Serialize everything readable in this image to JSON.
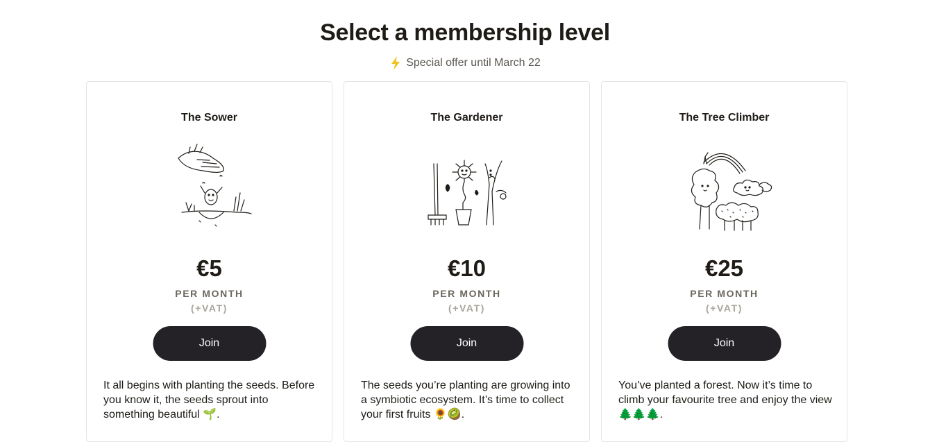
{
  "page": {
    "title": "Select a membership level",
    "offer_text": "Special offer until March 22",
    "offer_icon": "lightning-bolt-icon",
    "accent": "#f2c21b"
  },
  "plans": [
    {
      "name": "The Sower",
      "illustration": "seed-sowing-illustration",
      "price": "€5",
      "period": "PER MONTH",
      "vat": "(+VAT)",
      "button": "Join",
      "description": "It all begins with planting the seeds. Before you know it, the seeds sprout into something beautiful 🌱."
    },
    {
      "name": "The Gardener",
      "illustration": "gardener-flower-illustration",
      "price": "€10",
      "period": "PER MONTH",
      "vat": "(+VAT)",
      "button": "Join",
      "description": "The seeds you’re planting are growing into a symbiotic ecosystem. It’s time to collect your first fruits 🌻🥝."
    },
    {
      "name": "The Tree Climber",
      "illustration": "tree-climber-illustration",
      "price": "€25",
      "period": "PER MONTH",
      "vat": "(+VAT)",
      "button": "Join",
      "description": "You’ve planted a forest. Now it’s time to climb your favourite tree and enjoy the view 🌲🌲🌲."
    }
  ],
  "colors": {
    "button_bg": "#242226",
    "card_border": "#e6e4e0",
    "text": "#1f1c17"
  }
}
